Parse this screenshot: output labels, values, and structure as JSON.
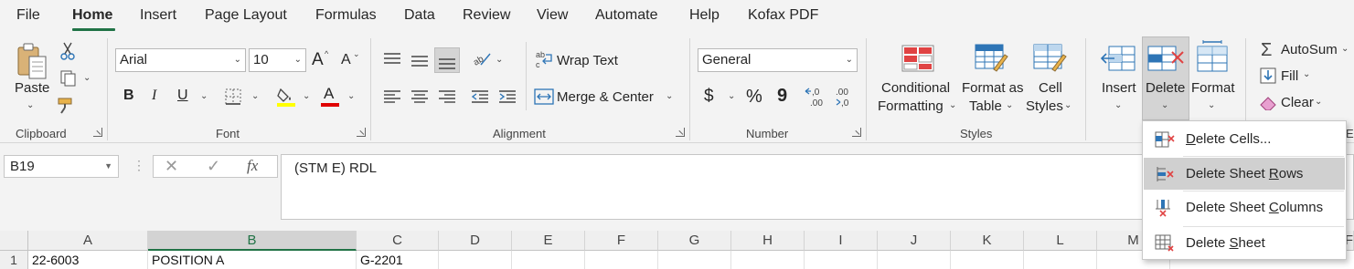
{
  "tabs": [
    {
      "label": "File"
    },
    {
      "label": "Home"
    },
    {
      "label": "Insert"
    },
    {
      "label": "Page Layout"
    },
    {
      "label": "Formulas"
    },
    {
      "label": "Data"
    },
    {
      "label": "Review"
    },
    {
      "label": "View"
    },
    {
      "label": "Automate"
    },
    {
      "label": "Help"
    },
    {
      "label": "Kofax PDF"
    }
  ],
  "ribbon": {
    "clipboard": {
      "paste": "Paste",
      "group": "Clipboard"
    },
    "font": {
      "name": "Arial",
      "size": "10",
      "group": "Font",
      "bold": "B",
      "italic": "I",
      "underline": "U",
      "grow": "A",
      "shrink": "A",
      "font_color": "A"
    },
    "alignment": {
      "wrap": "Wrap Text",
      "merge": "Merge & Center",
      "group": "Alignment"
    },
    "number": {
      "format": "General",
      "currency": "$",
      "percent": "%",
      "comma": "9",
      "inc": "←0\n.00",
      "dec": ".00\n→0",
      "group": "Number"
    },
    "styles": {
      "cond_1": "Conditional",
      "cond_2": "Formatting",
      "fmt_1": "Format as",
      "fmt_2": "Table",
      "cell_1": "Cell",
      "cell_2": "Styles",
      "group": "Styles"
    },
    "cells": {
      "insert": "Insert",
      "delete": "Delete",
      "format": "Format"
    },
    "editing": {
      "autosum": "AutoSum",
      "fill": "Fill",
      "clear": "Clear",
      "group": "Ed"
    }
  },
  "formula_bar": {
    "name_box": "B19",
    "fx": "fx",
    "value": "(STM E) RDL"
  },
  "grid": {
    "columns": [
      "A",
      "B",
      "C",
      "D",
      "E",
      "F",
      "G",
      "H",
      "I",
      "J",
      "K",
      "L",
      "M",
      "F"
    ],
    "row_number": "1",
    "row1": [
      "22-6003",
      "POSITION A",
      "G-2201"
    ]
  },
  "delete_menu": {
    "items": [
      {
        "pre": "",
        "u": "D",
        "post": "elete Cells..."
      },
      {
        "pre": "Delete Sheet ",
        "u": "R",
        "post": "ows"
      },
      {
        "pre": "Delete Sheet ",
        "u": "C",
        "post": "olumns"
      },
      {
        "pre": "Delete ",
        "u": "S",
        "post": "heet"
      }
    ]
  },
  "colors": {
    "accent": "#217346",
    "delete_red": "#e04343",
    "icon_blue": "#2e75b6"
  }
}
